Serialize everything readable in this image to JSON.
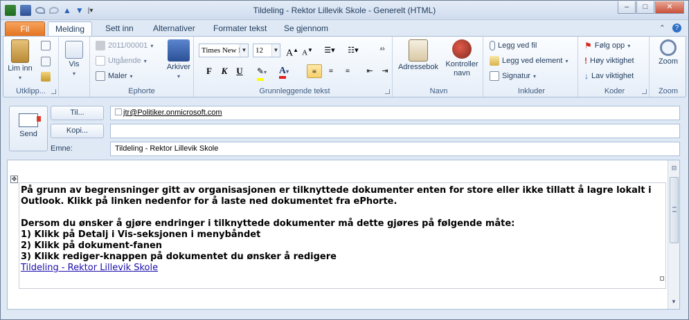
{
  "window": {
    "title": "Tildeling - Rektor Lillevik Skole  -  Generelt (HTML)",
    "minimize": "–",
    "maximize": "□",
    "close": "✕"
  },
  "tabs": {
    "file": "Fil",
    "items": [
      "Melding",
      "Sett inn",
      "Alternativer",
      "Formater tekst",
      "Se gjennom"
    ],
    "active": "Melding"
  },
  "ribbon": {
    "clipboard": {
      "paste_label": "Lim inn",
      "group_label": "Utklipp..."
    },
    "view": {
      "label": "Vis"
    },
    "ephorte": {
      "case_number": "2011/00001",
      "outgoing": "Utgående",
      "templates": "Maler",
      "archive": "Arkiver",
      "group_label": "Ephorte"
    },
    "basic_text": {
      "font_name": "Times New R",
      "font_size": "12",
      "bold": "F",
      "italic": "K",
      "underline": "U",
      "group_label": "Grunnleggende tekst",
      "highlight_color": "#ffff00",
      "font_color": "#e02020"
    },
    "names": {
      "address_book": "Adressebok",
      "check_names": "Kontroller navn",
      "group_label": "Navn"
    },
    "include": {
      "attach_file": "Legg ved fil",
      "attach_item": "Legg ved element",
      "signature": "Signatur",
      "group_label": "Inkluder"
    },
    "tags": {
      "follow_up": "Følg opp",
      "high_importance": "Høy viktighet",
      "low_importance": "Lav viktighet",
      "group_label": "Koder"
    },
    "zoom": {
      "zoom": "Zoom",
      "group_label": "Zoom"
    }
  },
  "header": {
    "send": "Send",
    "to_button": "Til...",
    "cc_button": "Kopi...",
    "subject_label": "Emne:",
    "to_value": "jtr@Politiker.onmicrosoft.com",
    "cc_value": "",
    "subject_value": "Tildeling - Rektor Lillevik Skole"
  },
  "body": {
    "para1": "På grunn av begrensninger gitt av organisasjonen er tilknyttede dokumenter enten for store eller ikke tillatt å lagre lokalt i Outlook. Klikk på linken nedenfor for å laste ned dokumentet fra ePhorte.",
    "para2": "Dersom du ønsker å gjøre endringer i tilknyttede dokumenter må dette gjøres på følgende måte:",
    "step1": "1) Klikk på Detalj i Vis-seksjonen i menybåndet",
    "step2": "2) Klikk på dokument-fanen",
    "step3": "3) Klikk rediger-knappen på dokumentet du ønsker å redigere",
    "link": "Tildeling - Rektor Lillevik Skole"
  }
}
